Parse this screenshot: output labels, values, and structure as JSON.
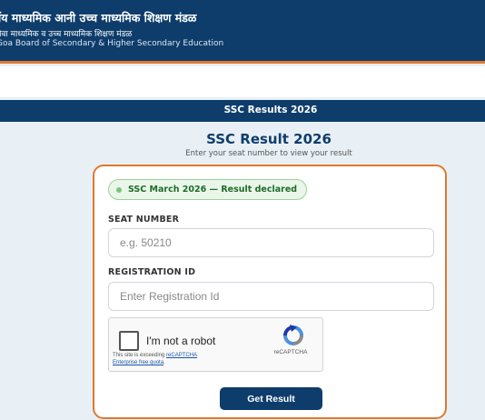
{
  "header": {
    "line1": "गोंय माध्यमिक आनी उच्च माध्यमिक शिक्षण मंडळ",
    "line2": "गोवा माध्यमिक व उच्च माध्यमिक शिक्षण मंडळ",
    "line3": "Goa Board of Secondary & Higher Secondary Education"
  },
  "nav": {
    "title": "SSC Results 2026"
  },
  "page": {
    "title": "SSC Result 2026",
    "subtitle": "Enter your seat number to view your result"
  },
  "form": {
    "status_badge": "SSC March 2026 — Result declared",
    "seat_label": "SEAT NUMBER",
    "seat_placeholder": "e.g. 50210",
    "reg_label": "REGISTRATION ID",
    "reg_placeholder": "Enter Registration Id",
    "captcha": {
      "label": "I'm not a robot",
      "brand": "reCAPTCHA",
      "note_prefix": "This site is exceeding ",
      "note_link1": "reCAPTCHA",
      "note_link2": "Enterprise free quota",
      "note_suffix": "."
    },
    "submit_label": "Get Result"
  },
  "colors": {
    "primary": "#0e3d6b",
    "accent": "#e2782d",
    "badge_bg": "#eaf6ea",
    "badge_text": "#1f6b28"
  },
  "icons": {
    "captcha": "recaptcha-logo-icon",
    "status": "status-dot-icon"
  }
}
